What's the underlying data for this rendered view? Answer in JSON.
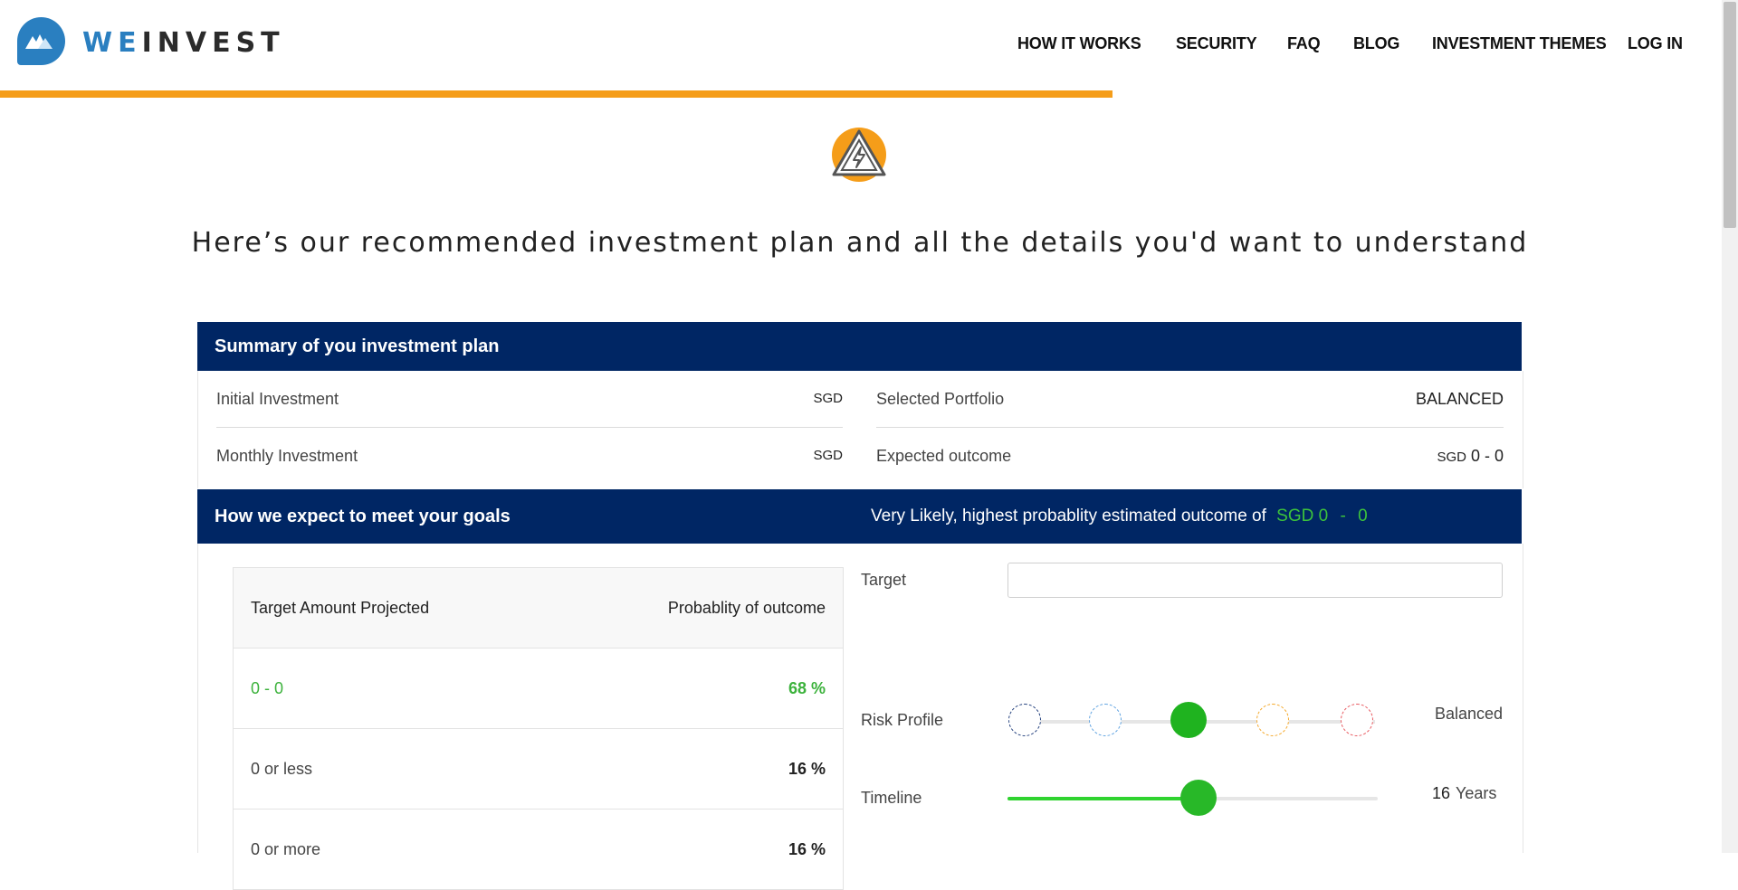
{
  "brand": {
    "name_we": "WE",
    "name_invest": "INVEST",
    "color": "#2a7fc0"
  },
  "nav": {
    "items": [
      "HOW IT WORKS",
      "SECURITY",
      "FAQ",
      "BLOG",
      "INVESTMENT THEMES",
      "LOG IN"
    ]
  },
  "progress": {
    "fraction": 0.646,
    "color": "#f59d19"
  },
  "hero": {
    "icon": "warning-bolt-icon",
    "title": "Here’s our recommended investment plan and all the details you'd want to understand"
  },
  "summary": {
    "title": "Summary of you investment plan",
    "initial_label": "Initial Investment",
    "initial_currency": "SGD",
    "monthly_label": "Monthly Investment",
    "monthly_currency": "SGD",
    "portfolio_label": "Selected Portfolio",
    "portfolio_value": "BALANCED",
    "outcome_label": "Expected outcome",
    "outcome_currency": "SGD",
    "outcome_value": "0 - 0"
  },
  "goals": {
    "title": "How we expect to meet your goals",
    "likely_text": "Very Likely, highest probablity estimated outcome of",
    "likely_amount": "SGD 0",
    "likely_sep": "-",
    "likely_amount_high": "0"
  },
  "table": {
    "col_amount": "Target Amount Projected",
    "col_prob": "Probablity of outcome",
    "rows": [
      {
        "amount": "0 - 0",
        "prob": "68 %"
      },
      {
        "amount": "0 or less",
        "prob": "16 %"
      },
      {
        "amount": "0 or more",
        "prob": "16 %"
      }
    ]
  },
  "controls": {
    "target_label": "Target",
    "target_value": "",
    "risk_label": "Risk Profile",
    "risk_value": "Balanced",
    "risk_levels": [
      {
        "color": "#1d3b7a",
        "active": false
      },
      {
        "color": "#5aa0e0",
        "active": false
      },
      {
        "color": "#1fb31f",
        "active": true
      },
      {
        "color": "#f5a623",
        "active": false
      },
      {
        "color": "#e8545b",
        "active": false
      }
    ],
    "timeline_label": "Timeline",
    "timeline_value": "16",
    "timeline_unit": "Years",
    "timeline_fraction": 0.515
  },
  "colors": {
    "navy": "#002664",
    "green": "#3cb23c",
    "orange": "#f59d19"
  }
}
